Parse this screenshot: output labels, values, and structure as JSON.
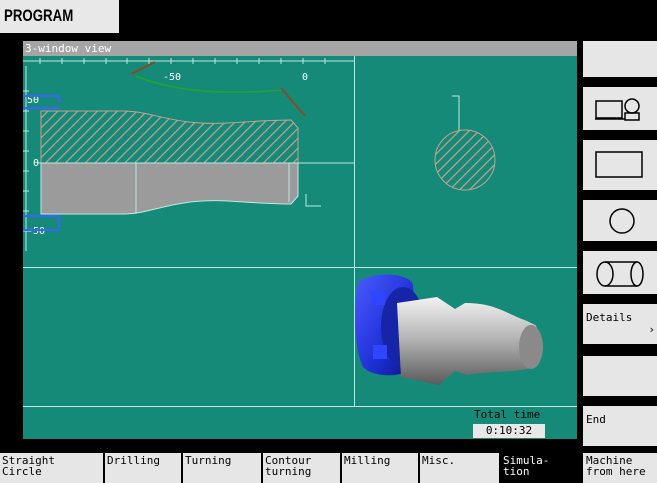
{
  "header": {
    "title": "PROGRAM"
  },
  "window": {
    "title": "3-window view"
  },
  "sideview": {
    "x_ticks": [
      "-50",
      "0"
    ],
    "y_ticks": [
      "50",
      "0",
      "-50"
    ]
  },
  "status": {
    "total_time_label": "Total time",
    "total_time_value": "0:10:32"
  },
  "softkeys_right": [
    {
      "label": "",
      "icon": ""
    },
    {
      "label": "",
      "icon": "machine-view-icon"
    },
    {
      "label": "",
      "icon": "rectangle-view-icon"
    },
    {
      "label": "",
      "icon": "circle-view-icon"
    },
    {
      "label": "",
      "icon": "cylinder-view-icon"
    },
    {
      "label": "Details",
      "icon": "chevron-right-icon",
      "chevron": "›"
    },
    {
      "label": "",
      "icon": ""
    },
    {
      "label": "End",
      "icon": ""
    },
    {
      "label": "Machine\nfrom here",
      "icon": ""
    }
  ],
  "softkeys_bottom": [
    "Straight\nCircle",
    "Drilling",
    "Turning",
    "Contour\nturning",
    "Milling",
    "Misc.",
    "Simula-\ntion"
  ],
  "colors": {
    "view_background": "#158a78",
    "softkey": "#e6e6e6",
    "hatch": "#c8a090",
    "chuck": "#1e2fd6",
    "axis_marker": "#3a63ff",
    "tool_path": "#27a32b",
    "tool_holder": "#8a4a22"
  }
}
